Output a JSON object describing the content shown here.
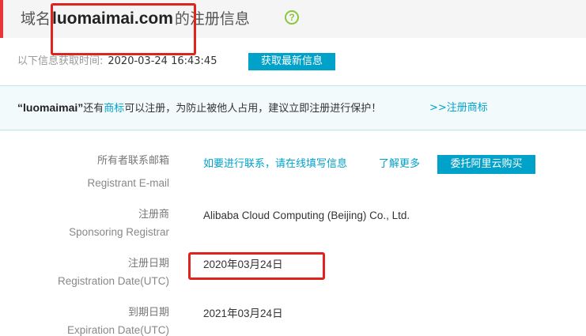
{
  "header": {
    "title_prefix": "域名",
    "domain": "luomaimai.com",
    "title_suffix": "的注册信息",
    "help_icon": "?",
    "accent_color": "#e8353b"
  },
  "fetch": {
    "label": "以下信息获取时间:",
    "time": "2020-03-24 16:43:45",
    "refresh_button": "获取最新信息"
  },
  "notice": {
    "domain_quoted": "“luomaimai”",
    "text_before_link": "还有",
    "trademark_link": "商标",
    "text_after_link": "可以注册，为防止被他人占用，建议立即注册进行保护！",
    "register_link": ">>注册商标"
  },
  "rows": [
    {
      "label_cn": "所有者联系邮箱",
      "label_en": "Registrant E-mail",
      "contact_link": "如要进行联系，请在线填写信息",
      "learn_more_link": "了解更多",
      "buy_button": "委托阿里云购买"
    },
    {
      "label_cn": "注册商",
      "label_en": "Sponsoring Registrar",
      "value": "Alibaba Cloud Computing (Beijing) Co., Ltd."
    },
    {
      "label_cn": "注册日期",
      "label_en": "Registration Date(UTC)",
      "value": "2020年03月24日"
    },
    {
      "label_cn": "到期日期",
      "label_en": "Expiration Date(UTC)",
      "value": "2021年03月24日"
    }
  ],
  "colors": {
    "link": "#00a2ca",
    "button": "#00a2ca",
    "highlight": "#e0231c",
    "help_icon": "#8cc63f"
  }
}
